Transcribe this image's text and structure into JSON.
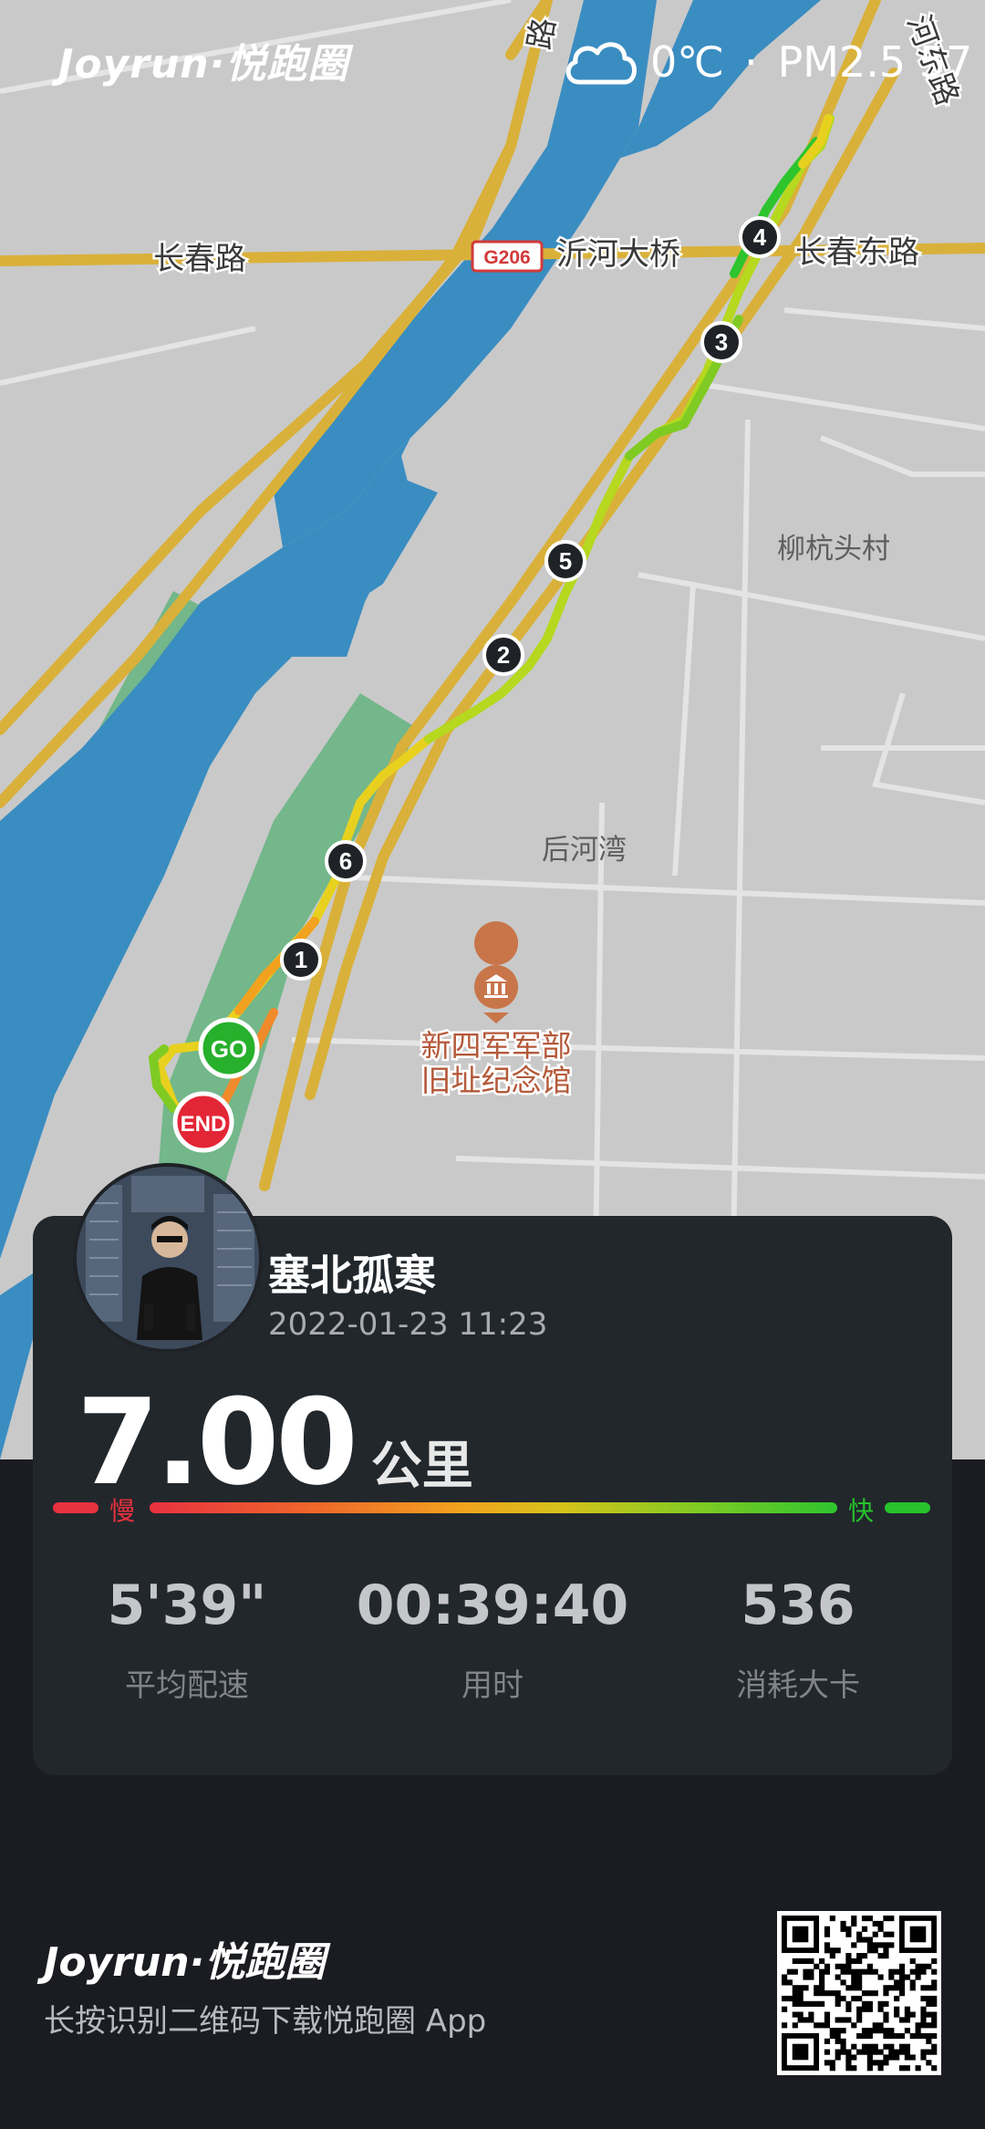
{
  "header": {
    "brand": "Joyrun·悦跑圈",
    "temperature": "0℃",
    "separator": "·",
    "aqi": "PM2.5 57",
    "weather_icon": "cloud-icon"
  },
  "map": {
    "labels": {
      "road_changchun": "长春路",
      "road_changchun_east": "长春东路",
      "highway_badge": "G206",
      "bridge": "沂河大桥",
      "road_vertical_left": "路",
      "road_vertical_right": "河东路",
      "village_liuhang": "柳杭头村",
      "village_houhe": "后河湾",
      "museum_line1": "新四军军部",
      "museum_line2": "旧址纪念馆"
    },
    "km_markers": [
      "1",
      "2",
      "3",
      "4",
      "5",
      "6"
    ],
    "start_label": "GO",
    "end_label": "END",
    "colors": {
      "water": "#3a8dc1",
      "park": "#73b78a",
      "land": "#c9c9c9",
      "road": "#d9b13a"
    }
  },
  "runner": {
    "name": "塞北孤寒",
    "datetime": "2022-01-23 11:23"
  },
  "distance": {
    "value": "7.00",
    "unit": "公里"
  },
  "pace_legend": {
    "slow": "慢",
    "fast": "快"
  },
  "stats": [
    {
      "value": "5'39\"",
      "label": "平均配速"
    },
    {
      "value": "00:39:40",
      "label": "用时"
    },
    {
      "value": "536",
      "label": "消耗大卡"
    }
  ],
  "footer": {
    "brand": "Joyrun·悦跑圈",
    "hint": "长按识别二维码下载悦跑圈 App",
    "qr_icon": "qr-code-icon"
  }
}
